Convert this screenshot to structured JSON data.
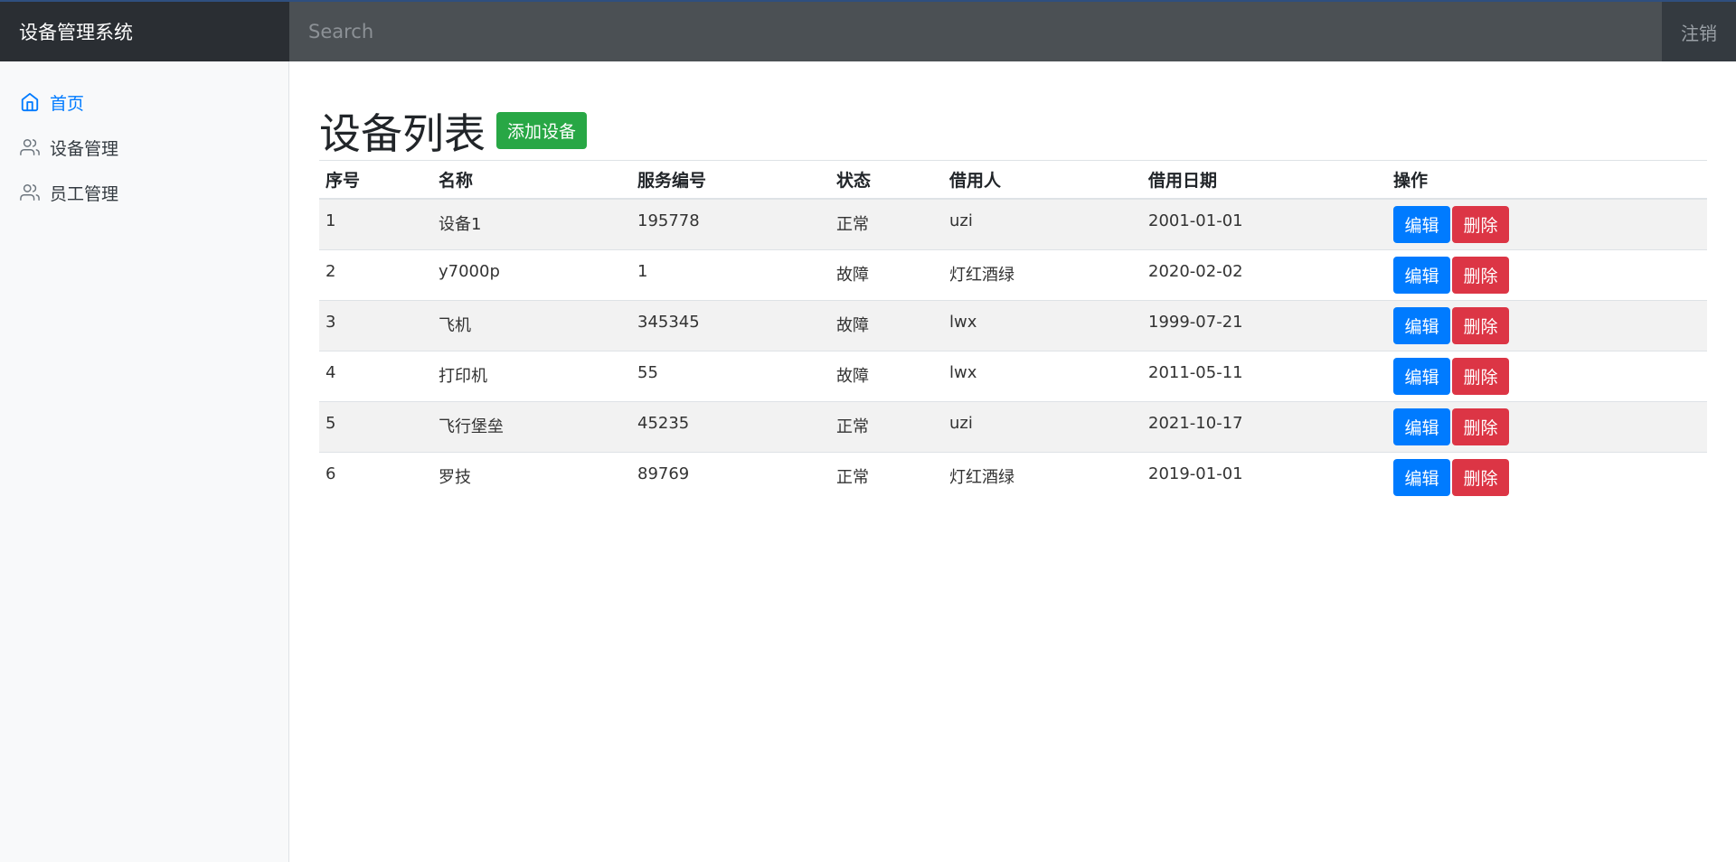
{
  "app": {
    "title": "设备管理系统",
    "logout_label": "注销"
  },
  "search": {
    "placeholder": "Search"
  },
  "sidebar": {
    "items": [
      {
        "label": "首页",
        "icon": "home-icon",
        "active": true
      },
      {
        "label": "设备管理",
        "icon": "users-icon",
        "active": false
      },
      {
        "label": "员工管理",
        "icon": "users-icon",
        "active": false
      }
    ]
  },
  "main": {
    "title": "设备列表",
    "add_label": "添加设备",
    "columns": [
      "序号",
      "名称",
      "服务编号",
      "状态",
      "借用人",
      "借用日期",
      "操作"
    ],
    "rows": [
      [
        "1",
        "设备1",
        "195778",
        "正常",
        "uzi",
        "2001-01-01"
      ],
      [
        "2",
        "y7000p",
        "1",
        "故障",
        "灯红酒绿",
        "2020-02-02"
      ],
      [
        "3",
        "飞机",
        "345345",
        "故障",
        "lwx",
        "1999-07-21"
      ],
      [
        "4",
        "打印机",
        "55",
        "故障",
        "lwx",
        "2011-05-11"
      ],
      [
        "5",
        "飞行堡垒",
        "45235",
        "正常",
        "uzi",
        "2021-10-17"
      ],
      [
        "6",
        "罗技",
        "89769",
        "正常",
        "灯红酒绿",
        "2019-01-01"
      ]
    ],
    "edit_label": "编辑",
    "delete_label": "删除"
  },
  "colors": {
    "accent": "#007bff",
    "success": "#28a745",
    "danger": "#dc3545",
    "navbar": "#343a40"
  }
}
